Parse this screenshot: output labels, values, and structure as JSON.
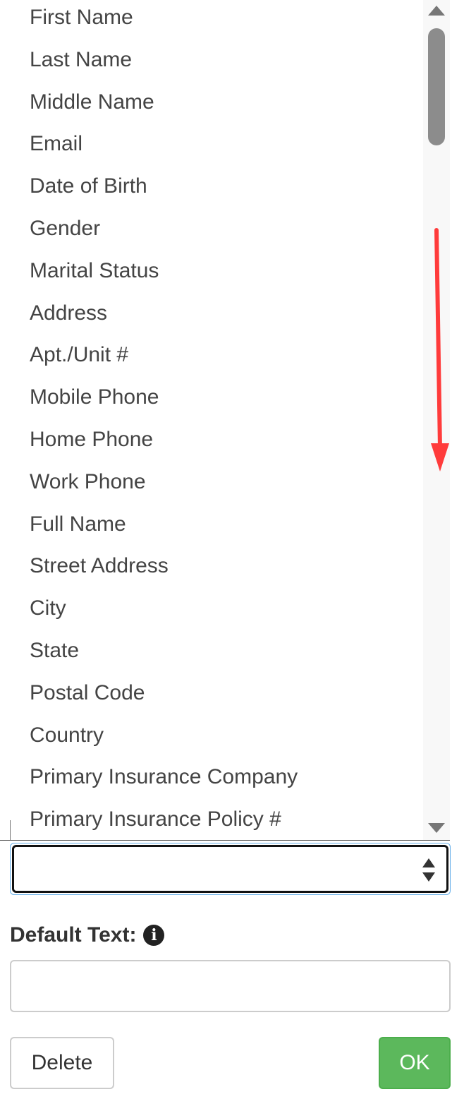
{
  "field_list": {
    "options": [
      "First Name",
      "Last Name",
      "Middle Name",
      "Email",
      "Date of Birth",
      "Gender",
      "Marital Status",
      "Address",
      "Apt./Unit #",
      "Mobile Phone",
      "Home Phone",
      "Work Phone",
      "Full Name",
      "Street Address",
      "City",
      "State",
      "Postal Code",
      "Country",
      "Primary Insurance Company",
      "Primary Insurance Policy #"
    ]
  },
  "field_select": {
    "value": ""
  },
  "default_text": {
    "label": "Default Text:",
    "info_icon": "info-circle-icon",
    "value": ""
  },
  "buttons": {
    "delete_label": "Delete",
    "ok_label": "OK"
  },
  "colors": {
    "ok_button": "#5cb85c",
    "annotation_arrow": "#ff3b3b",
    "focus_border": "#66afe9"
  }
}
